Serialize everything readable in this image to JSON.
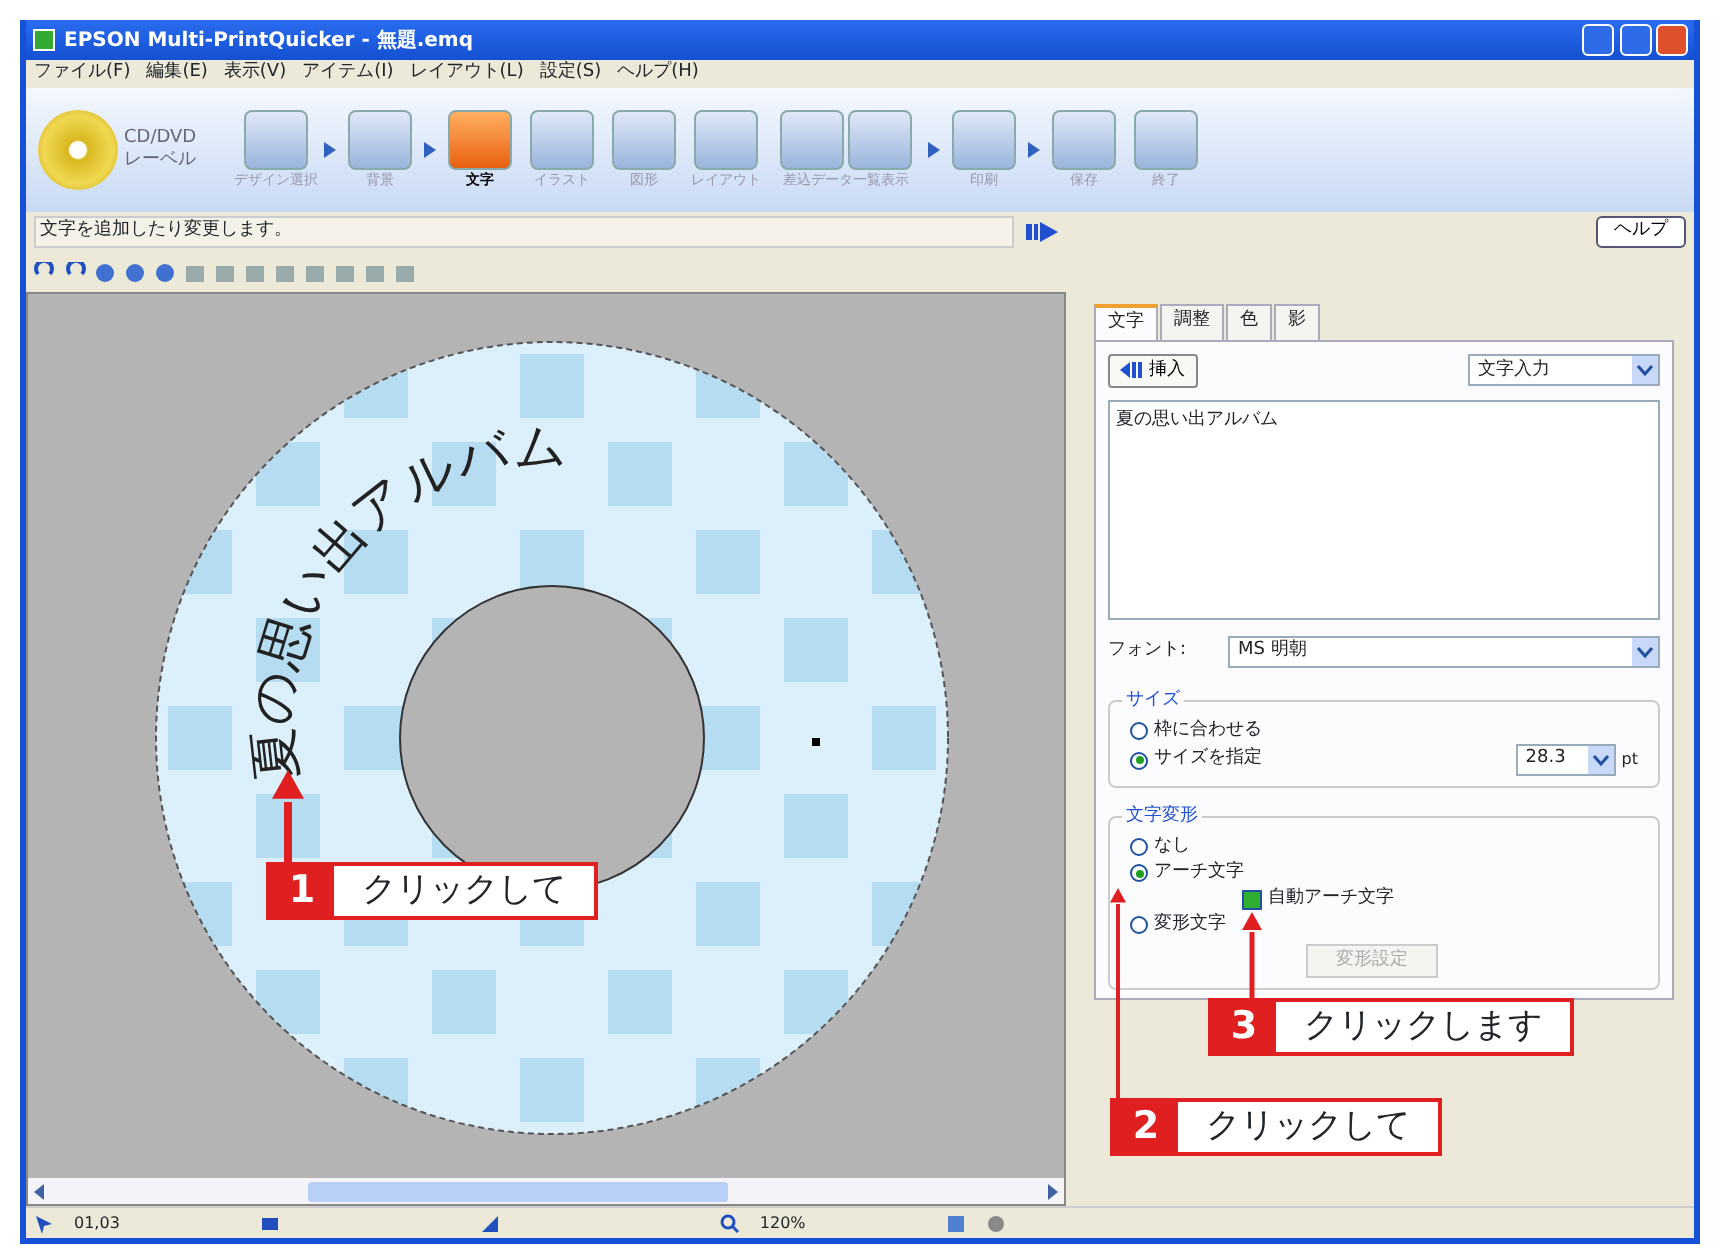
{
  "window": {
    "title": "EPSON Multi-PrintQuicker - 無題.emq"
  },
  "menu": [
    "ファイル(F)",
    "編集(E)",
    "表示(V)",
    "アイテム(I)",
    "レイアウト(L)",
    "設定(S)",
    "ヘルプ(H)"
  ],
  "logo": {
    "line_1": "CD/DVD",
    "line_2": "レーベル"
  },
  "steps": [
    {
      "kind": "single",
      "label": "デザイン選択",
      "selected": false,
      "arrow_after": true
    },
    {
      "kind": "single",
      "label": "背景",
      "selected": false,
      "arrow_after": true
    },
    {
      "kind": "single",
      "label": "文字",
      "selected": true,
      "arrow_after": false
    },
    {
      "kind": "single",
      "label": "イラスト",
      "selected": false,
      "arrow_after": false
    },
    {
      "kind": "single",
      "label": "図形",
      "selected": false,
      "arrow_after": false
    },
    {
      "kind": "single",
      "label": "レイアウト",
      "selected": false,
      "arrow_after": false
    },
    {
      "kind": "double",
      "label": "差込データ一覧表示",
      "selected": false,
      "arrow_after": true
    },
    {
      "kind": "single",
      "label": "印刷",
      "selected": false,
      "arrow_after": true
    },
    {
      "kind": "single",
      "label": "保存",
      "selected": false,
      "arrow_after": false
    },
    {
      "kind": "single",
      "label": "終了",
      "selected": false,
      "arrow_after": false
    }
  ],
  "hint": "文字を追加したり変更します。",
  "help_button": "ヘルプ",
  "disc": {
    "text": "夏の思い出アルバム"
  },
  "panel": {
    "tabs": [
      {
        "label": "文字",
        "selected": true
      },
      {
        "label": "調整",
        "selected": false
      },
      {
        "label": "色",
        "selected": false
      },
      {
        "label": "影",
        "selected": false
      }
    ],
    "insert_button": "挿入",
    "input_mode": "文字入力",
    "text_value": "夏の思い出アルバム",
    "font_label": "フォント:",
    "font_value": "MS 明朝",
    "size_group": {
      "title": "サイズ",
      "options": [
        {
          "label": "枠に合わせる",
          "selected": false
        },
        {
          "label": "サイズを指定",
          "selected": true
        }
      ],
      "size_value": "28.3",
      "unit": "pt"
    },
    "transform_group": {
      "title": "文字変形",
      "options": [
        {
          "label": "なし",
          "selected": false
        },
        {
          "label": "アーチ文字",
          "selected": true
        },
        {
          "label": "変形文字",
          "selected": false
        }
      ],
      "auto_arch": {
        "label": "自動アーチ文字",
        "checked": true
      },
      "settings_button": {
        "label": "変形設定",
        "disabled": true
      }
    }
  },
  "status_bar": [
    "01,03",
    "120%"
  ],
  "callouts": [
    {
      "number": "1",
      "label": "クリックして"
    },
    {
      "number": "3",
      "label": "クリックします"
    },
    {
      "number": "2",
      "label": "クリックして"
    }
  ]
}
